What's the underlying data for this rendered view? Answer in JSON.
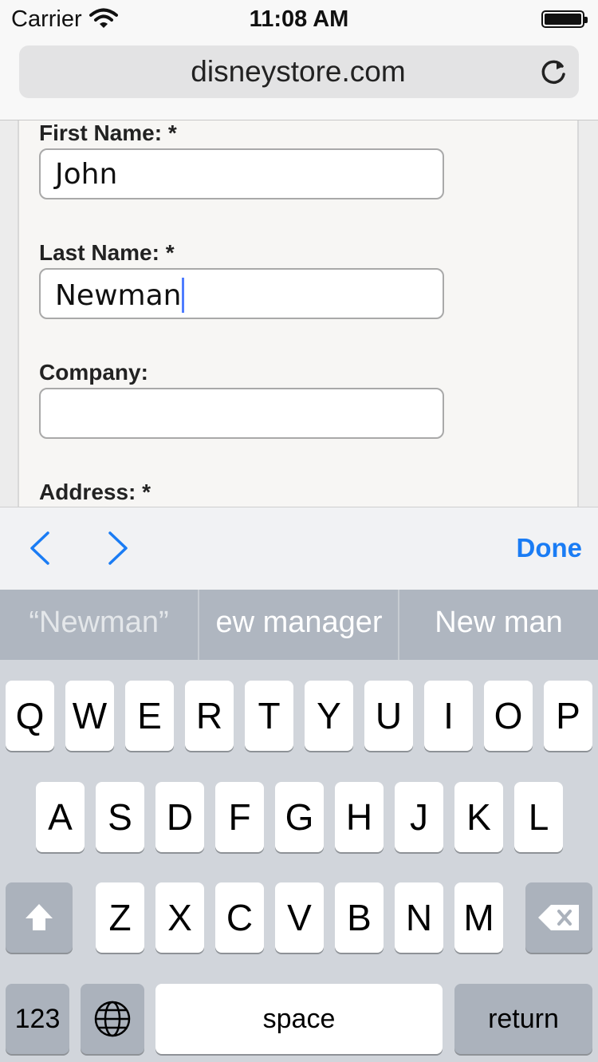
{
  "status": {
    "carrier": "Carrier",
    "time": "11:08 AM"
  },
  "browser": {
    "url": "disneystore.com"
  },
  "form": {
    "first_name_label": "First Name: *",
    "first_name_value": "John",
    "last_name_label": "Last Name: *",
    "last_name_value": "Newman",
    "company_label": "Company:",
    "company_value": "",
    "address_label": "Address: *"
  },
  "accessory": {
    "done_label": "Done"
  },
  "suggestions": [
    "“Newman”",
    "ew manager",
    "New man"
  ],
  "keyboard": {
    "row1": [
      "Q",
      "W",
      "E",
      "R",
      "T",
      "Y",
      "U",
      "I",
      "O",
      "P"
    ],
    "row2": [
      "A",
      "S",
      "D",
      "F",
      "G",
      "H",
      "J",
      "K",
      "L"
    ],
    "row3": [
      "Z",
      "X",
      "C",
      "V",
      "B",
      "N",
      "M"
    ],
    "numbers_label": "123",
    "space_label": "space",
    "return_label": "return"
  }
}
